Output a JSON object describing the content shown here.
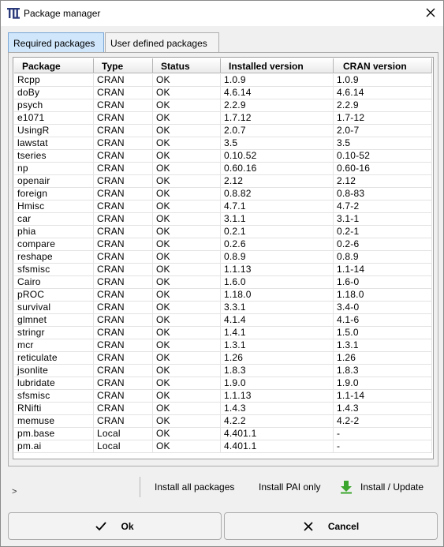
{
  "window": {
    "title": "Package manager",
    "app_icon": "pai-logo-icon",
    "close_icon": "close-icon"
  },
  "tabs": [
    {
      "label": "Required packages",
      "active": true
    },
    {
      "label": "User defined packages",
      "active": false
    }
  ],
  "table": {
    "columns": [
      "Package",
      "Type",
      "Status",
      "Installed version",
      "CRAN version"
    ],
    "rows": [
      [
        "Rcpp",
        "CRAN",
        "OK",
        "1.0.9",
        "1.0.9"
      ],
      [
        "doBy",
        "CRAN",
        "OK",
        "4.6.14",
        "4.6.14"
      ],
      [
        "psych",
        "CRAN",
        "OK",
        "2.2.9",
        "2.2.9"
      ],
      [
        "e1071",
        "CRAN",
        "OK",
        "1.7.12",
        "1.7-12"
      ],
      [
        "UsingR",
        "CRAN",
        "OK",
        "2.0.7",
        "2.0-7"
      ],
      [
        "lawstat",
        "CRAN",
        "OK",
        "3.5",
        "3.5"
      ],
      [
        "tseries",
        "CRAN",
        "OK",
        "0.10.52",
        "0.10-52"
      ],
      [
        "np",
        "CRAN",
        "OK",
        "0.60.16",
        "0.60-16"
      ],
      [
        "openair",
        "CRAN",
        "OK",
        "2.12",
        "2.12"
      ],
      [
        "foreign",
        "CRAN",
        "OK",
        "0.8.82",
        "0.8-83"
      ],
      [
        "Hmisc",
        "CRAN",
        "OK",
        "4.7.1",
        "4.7-2"
      ],
      [
        "car",
        "CRAN",
        "OK",
        "3.1.1",
        "3.1-1"
      ],
      [
        "phia",
        "CRAN",
        "OK",
        "0.2.1",
        "0.2-1"
      ],
      [
        "compare",
        "CRAN",
        "OK",
        "0.2.6",
        "0.2-6"
      ],
      [
        "reshape",
        "CRAN",
        "OK",
        "0.8.9",
        "0.8.9"
      ],
      [
        "sfsmisc",
        "CRAN",
        "OK",
        "1.1.13",
        "1.1-14"
      ],
      [
        "Cairo",
        "CRAN",
        "OK",
        "1.6.0",
        "1.6-0"
      ],
      [
        "pROC",
        "CRAN",
        "OK",
        "1.18.0",
        "1.18.0"
      ],
      [
        "survival",
        "CRAN",
        "OK",
        "3.3.1",
        "3.4-0"
      ],
      [
        "glmnet",
        "CRAN",
        "OK",
        "4.1.4",
        "4.1-6"
      ],
      [
        "stringr",
        "CRAN",
        "OK",
        "1.4.1",
        "1.5.0"
      ],
      [
        "mcr",
        "CRAN",
        "OK",
        "1.3.1",
        "1.3.1"
      ],
      [
        "reticulate",
        "CRAN",
        "OK",
        "1.26",
        "1.26"
      ],
      [
        "jsonlite",
        "CRAN",
        "OK",
        "1.8.3",
        "1.8.3"
      ],
      [
        "lubridate",
        "CRAN",
        "OK",
        "1.9.0",
        "1.9.0"
      ],
      [
        "sfsmisc",
        "CRAN",
        "OK",
        "1.1.13",
        "1.1-14"
      ],
      [
        "RNifti",
        "CRAN",
        "OK",
        "1.4.3",
        "1.4.3"
      ],
      [
        "memuse",
        "CRAN",
        "OK",
        "4.2.2",
        "4.2-2"
      ],
      [
        "pm.base",
        "Local",
        "OK",
        "4.401.1",
        "-"
      ],
      [
        "pm.ai",
        "Local",
        "OK",
        "4.401.1",
        "-"
      ]
    ]
  },
  "actions": {
    "prompt": ">",
    "install_all": "Install all packages",
    "install_pai": "Install PAI only",
    "install_update": "Install / Update",
    "install_update_icon": "download-arrow-icon"
  },
  "footer": {
    "ok_label": "Ok",
    "ok_icon": "checkmark-icon",
    "cancel_label": "Cancel",
    "cancel_icon": "x-icon"
  },
  "colors": {
    "active_tab": "#cfe6fb",
    "download_arrow": "#3aa52c"
  }
}
